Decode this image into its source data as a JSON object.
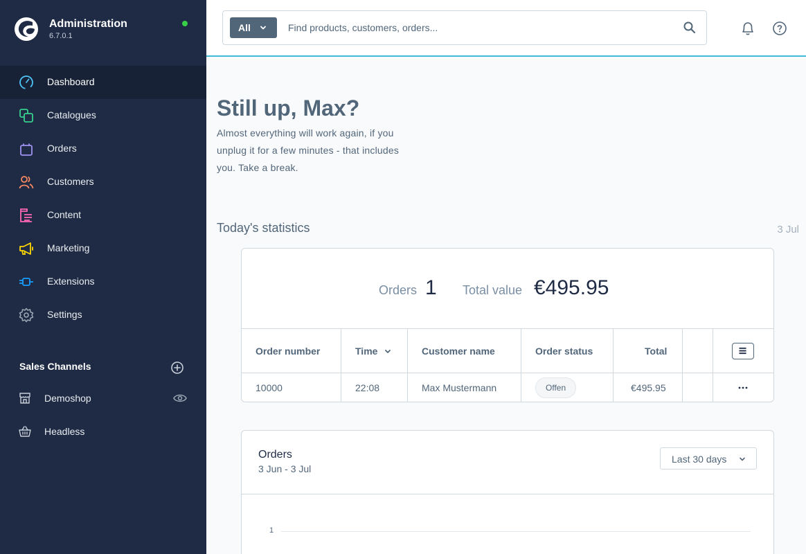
{
  "app": {
    "title": "Administration",
    "version": "6.7.0.1",
    "status": "online"
  },
  "nav": {
    "items": [
      {
        "label": "Dashboard",
        "icon": "gauge-icon",
        "color": "#4fc3f7",
        "active": true
      },
      {
        "label": "Catalogues",
        "icon": "catalogue-icon",
        "color": "#37d08e"
      },
      {
        "label": "Orders",
        "icon": "shopping-bag-icon",
        "color": "#a092f0"
      },
      {
        "label": "Customers",
        "icon": "customers-icon",
        "color": "#f88962"
      },
      {
        "label": "Content",
        "icon": "content-icon",
        "color": "#ff68b4"
      },
      {
        "label": "Marketing",
        "icon": "megaphone-icon",
        "color": "#ffd700"
      },
      {
        "label": "Extensions",
        "icon": "plug-icon",
        "color": "#189eff"
      },
      {
        "label": "Settings",
        "icon": "gear-icon",
        "color": "#9aa8b5"
      }
    ]
  },
  "sales_channels": {
    "header": "Sales Channels",
    "items": [
      {
        "label": "Demoshop",
        "icon": "storefront-icon"
      },
      {
        "label": "Headless",
        "icon": "basket-icon"
      }
    ]
  },
  "search": {
    "type_label": "All",
    "placeholder": "Find products, customers, orders..."
  },
  "greeting": {
    "title": "Still up, Max?",
    "text": "Almost everything will work again, if you unplug it for a few minutes - that includes you. Take a break."
  },
  "statistics": {
    "title": "Today's statistics",
    "date": "3 Jul",
    "orders_label": "Orders",
    "orders_value": "1",
    "total_label": "Total value",
    "total_value": "€495.95",
    "table": {
      "headers": [
        "Order number",
        "Time",
        "Customer name",
        "Order status",
        "Total"
      ],
      "rows": [
        {
          "order_number": "10000",
          "time": "22:08",
          "customer": "Max Mustermann",
          "status": "Offen",
          "total": "€495.95"
        }
      ]
    }
  },
  "orders_chart": {
    "title": "Orders",
    "range": "3 Jun - 3 Jul",
    "period": "Last 30 days",
    "y_tick": "1"
  },
  "colors": {
    "sidebar": "#1f2b44",
    "sidebar_active": "#172236",
    "accent": "#43b9d8",
    "status_online": "#37d046"
  }
}
